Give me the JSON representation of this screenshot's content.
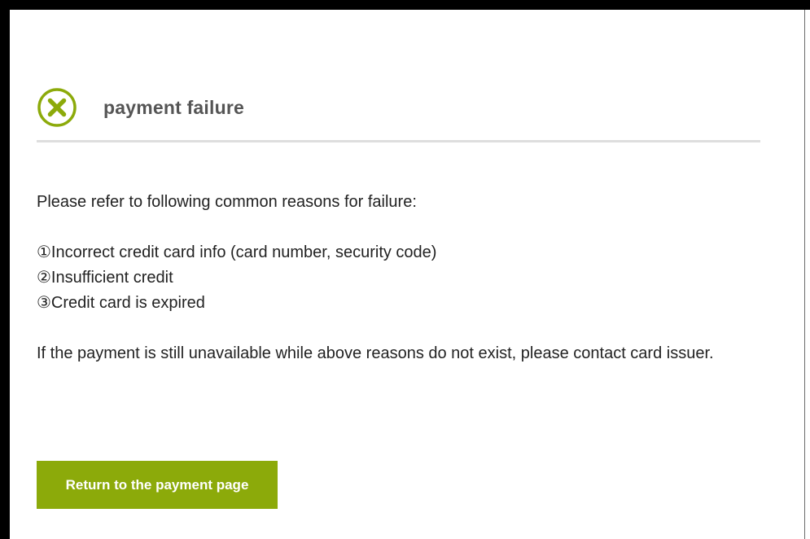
{
  "header": {
    "icon": "error-circle-x-icon",
    "title": "payment failure"
  },
  "content": {
    "intro": "Please refer to following common reasons for failure:",
    "reasons": [
      "①Incorrect credit card info (card number, security code)",
      "②Insufficient credit",
      "③Credit card is expired"
    ],
    "note": "If the payment is still unavailable while above reasons do not exist, please contact card issuer."
  },
  "actions": {
    "return_label": "Return to the payment page"
  },
  "colors": {
    "accent": "#8caa0a",
    "title": "#555555",
    "text": "#222222",
    "divider": "#dedede",
    "background": "#ffffff",
    "frame": "#000000"
  }
}
